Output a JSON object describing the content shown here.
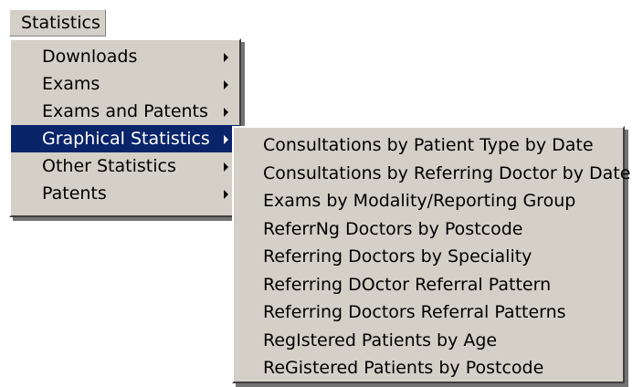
{
  "menubar": {
    "title": "Statistics"
  },
  "main_menu": {
    "items": [
      {
        "label": "Downloads",
        "has_submenu": true,
        "selected": false
      },
      {
        "label": "Exams",
        "has_submenu": true,
        "selected": false
      },
      {
        "label": "Exams and Patents",
        "has_submenu": true,
        "selected": false
      },
      {
        "label": "Graphical Statistics",
        "has_submenu": true,
        "selected": true
      },
      {
        "label": "Other Statistics",
        "has_submenu": true,
        "selected": false
      },
      {
        "label": "Patents",
        "has_submenu": true,
        "selected": false
      }
    ]
  },
  "submenu": {
    "items": [
      {
        "label": "Consultations by Patient Type by Date"
      },
      {
        "label": "Consultations by Referring Doctor by Date"
      },
      {
        "label": "Exams by Modality/Reporting Group"
      },
      {
        "label": "ReferrNg Doctors by Postcode"
      },
      {
        "label": "Referring Doctors by Speciality"
      },
      {
        "label": "Referring DOctor Referral Pattern"
      },
      {
        "label": "Referring Doctors Referral Patterns"
      },
      {
        "label": "RegIstered Patients by Age"
      },
      {
        "label": "ReGistered Patients by Postcode"
      }
    ]
  },
  "colors": {
    "menu_bg": "#d4d0c8",
    "highlight_bg": "#0a246a",
    "highlight_text": "#ffffff"
  }
}
